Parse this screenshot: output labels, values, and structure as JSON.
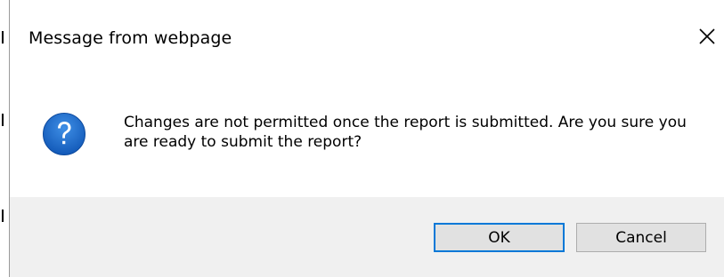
{
  "dialog": {
    "title": "Message from webpage",
    "close_icon": "close-icon",
    "icon": "question-icon",
    "message": "Changes are not permitted once the report is submitted. Are you sure you are ready to submit the report?",
    "buttons": {
      "ok_label": "OK",
      "cancel_label": "Cancel"
    }
  },
  "colors": {
    "icon_blue": "#1b6ac9",
    "footer_bg": "#f0f0f0",
    "default_button_border": "#0078d7"
  }
}
